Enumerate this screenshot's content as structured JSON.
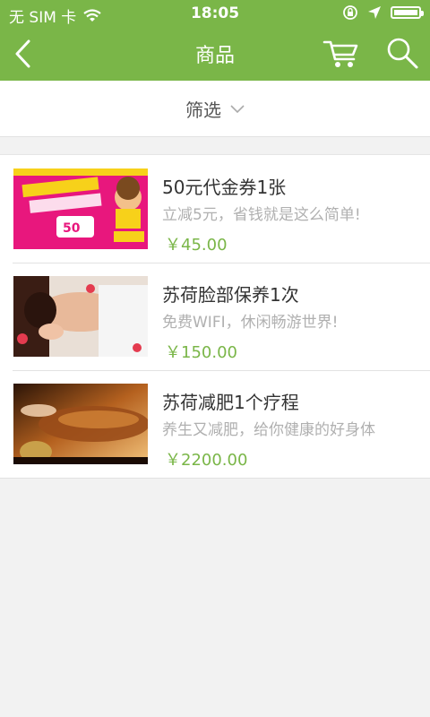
{
  "status_bar": {
    "carrier": "无 SIM 卡",
    "time": "18:05"
  },
  "nav": {
    "title": "商品",
    "back_icon": "back-chevron-icon",
    "cart_icon": "cart-icon",
    "search_icon": "search-icon"
  },
  "filter": {
    "label": "筛选"
  },
  "products": [
    {
      "title": "50元代金券1张",
      "subtitle": "立减5元，省钱就是这么简单!",
      "price": "￥45.00"
    },
    {
      "title": "苏荷脸部保养1次",
      "subtitle": "免费WIFI，休闲畅游世界!",
      "price": "￥150.00"
    },
    {
      "title": "苏荷减肥1个疗程",
      "subtitle": "养生又减肥，给你健康的好身体",
      "price": "￥2200.00"
    }
  ],
  "colors": {
    "accent": "#7ab648",
    "background": "#f2f2f2"
  }
}
